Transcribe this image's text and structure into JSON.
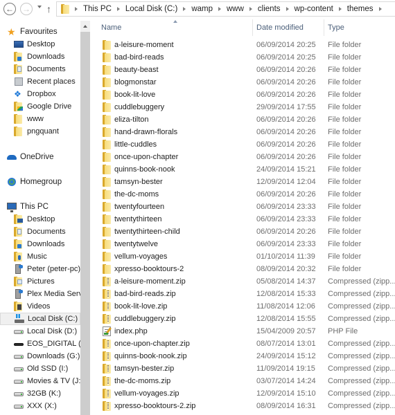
{
  "navbar": {
    "back_label": "Back",
    "forward_label": "Forward",
    "recent_label": "Recent locations",
    "up_label": "Up",
    "breadcrumbs": [
      "This PC",
      "Local Disk (C:)",
      "wamp",
      "www",
      "clients",
      "wp-content",
      "themes"
    ]
  },
  "sidebar": {
    "favourites": {
      "label": "Favourites",
      "items": [
        {
          "label": "Desktop",
          "icon": "desktop-icon"
        },
        {
          "label": "Downloads",
          "icon": "downloads-folder-icon"
        },
        {
          "label": "Documents",
          "icon": "documents-folder-icon"
        },
        {
          "label": "Recent places",
          "icon": "recent-places-icon"
        },
        {
          "label": "Dropbox",
          "icon": "dropbox-icon"
        },
        {
          "label": "Google Drive",
          "icon": "google-drive-folder-icon"
        },
        {
          "label": "www",
          "icon": "folder-icon"
        },
        {
          "label": "pngquant",
          "icon": "folder-icon"
        }
      ]
    },
    "onedrive": {
      "label": "OneDrive"
    },
    "homegroup": {
      "label": "Homegroup"
    },
    "this_pc": {
      "label": "This PC",
      "items": [
        {
          "label": "Desktop",
          "icon": "desktop-folder-icon"
        },
        {
          "label": "Documents",
          "icon": "documents-folder-icon"
        },
        {
          "label": "Downloads",
          "icon": "downloads-folder-icon"
        },
        {
          "label": "Music",
          "icon": "music-folder-icon"
        },
        {
          "label": "Peter (peter-pc)",
          "icon": "network-location-icon"
        },
        {
          "label": "Pictures",
          "icon": "pictures-folder-icon"
        },
        {
          "label": "Plex Media Serve",
          "icon": "network-location-icon"
        },
        {
          "label": "Videos",
          "icon": "videos-folder-icon"
        },
        {
          "label": "Local Disk (C:)",
          "icon": "windows-drive-icon",
          "selected": true
        },
        {
          "label": "Local Disk (D:)",
          "icon": "hard-drive-icon"
        },
        {
          "label": "EOS_DIGITAL (F:)",
          "icon": "removable-drive-icon"
        },
        {
          "label": "Downloads (G:)",
          "icon": "hard-drive-icon"
        },
        {
          "label": "Old SSD (I:)",
          "icon": "hard-drive-icon"
        },
        {
          "label": "Movies & TV (J:)",
          "icon": "hard-drive-icon"
        },
        {
          "label": "32GB (K:)",
          "icon": "hard-drive-icon"
        },
        {
          "label": "XXX (X:)",
          "icon": "hard-drive-icon"
        }
      ]
    }
  },
  "file_list": {
    "columns": {
      "name": "Name",
      "date": "Date modified",
      "type": "Type"
    },
    "sort_column": "Name",
    "sort_direction": "ascending",
    "rows": [
      {
        "name": "a-leisure-moment",
        "date": "06/09/2014 20:25",
        "type": "File folder",
        "kind": "folder"
      },
      {
        "name": "bad-bird-reads",
        "date": "06/09/2014 20:25",
        "type": "File folder",
        "kind": "folder"
      },
      {
        "name": "beauty-beast",
        "date": "06/09/2014 20:26",
        "type": "File folder",
        "kind": "folder"
      },
      {
        "name": "blogmonstar",
        "date": "06/09/2014 20:26",
        "type": "File folder",
        "kind": "folder"
      },
      {
        "name": "book-lit-love",
        "date": "06/09/2014 20:26",
        "type": "File folder",
        "kind": "folder"
      },
      {
        "name": "cuddlebuggery",
        "date": "29/09/2014 17:55",
        "type": "File folder",
        "kind": "folder"
      },
      {
        "name": "eliza-tilton",
        "date": "06/09/2014 20:26",
        "type": "File folder",
        "kind": "folder"
      },
      {
        "name": "hand-drawn-florals",
        "date": "06/09/2014 20:26",
        "type": "File folder",
        "kind": "folder"
      },
      {
        "name": "little-cuddles",
        "date": "06/09/2014 20:26",
        "type": "File folder",
        "kind": "folder"
      },
      {
        "name": "once-upon-chapter",
        "date": "06/09/2014 20:26",
        "type": "File folder",
        "kind": "folder"
      },
      {
        "name": "quinns-book-nook",
        "date": "24/09/2014 15:21",
        "type": "File folder",
        "kind": "folder"
      },
      {
        "name": "tamsyn-bester",
        "date": "12/09/2014 12:04",
        "type": "File folder",
        "kind": "folder"
      },
      {
        "name": "the-dc-moms",
        "date": "06/09/2014 20:26",
        "type": "File folder",
        "kind": "folder"
      },
      {
        "name": "twentyfourteen",
        "date": "06/09/2014 23:33",
        "type": "File folder",
        "kind": "folder"
      },
      {
        "name": "twentythirteen",
        "date": "06/09/2014 23:33",
        "type": "File folder",
        "kind": "folder"
      },
      {
        "name": "twentythirteen-child",
        "date": "06/09/2014 20:26",
        "type": "File folder",
        "kind": "folder"
      },
      {
        "name": "twentytwelve",
        "date": "06/09/2014 23:33",
        "type": "File folder",
        "kind": "folder"
      },
      {
        "name": "vellum-voyages",
        "date": "01/10/2014 11:39",
        "type": "File folder",
        "kind": "folder"
      },
      {
        "name": "xpresso-booktours-2",
        "date": "08/09/2014 20:32",
        "type": "File folder",
        "kind": "folder"
      },
      {
        "name": "a-leisure-moment.zip",
        "date": "05/08/2014 14:37",
        "type": "Compressed (zipp...",
        "kind": "zip"
      },
      {
        "name": "bad-bird-reads.zip",
        "date": "12/08/2014 15:33",
        "type": "Compressed (zipp...",
        "kind": "zip"
      },
      {
        "name": "book-lit-love.zip",
        "date": "11/08/2014 12:06",
        "type": "Compressed (zipp...",
        "kind": "zip"
      },
      {
        "name": "cuddlebuggery.zip",
        "date": "12/08/2014 15:55",
        "type": "Compressed (zipp...",
        "kind": "zip"
      },
      {
        "name": "index.php",
        "date": "15/04/2009 20:57",
        "type": "PHP File",
        "kind": "php"
      },
      {
        "name": "once-upon-chapter.zip",
        "date": "08/07/2014 13:01",
        "type": "Compressed (zipp...",
        "kind": "zip"
      },
      {
        "name": "quinns-book-nook.zip",
        "date": "24/09/2014 15:12",
        "type": "Compressed (zipp...",
        "kind": "zip"
      },
      {
        "name": "tamsyn-bester.zip",
        "date": "11/09/2014 19:15",
        "type": "Compressed (zipp...",
        "kind": "zip"
      },
      {
        "name": "the-dc-moms.zip",
        "date": "03/07/2014 14:24",
        "type": "Compressed (zipp...",
        "kind": "zip"
      },
      {
        "name": "vellum-voyages.zip",
        "date": "12/09/2014 15:10",
        "type": "Compressed (zipp...",
        "kind": "zip"
      },
      {
        "name": "xpresso-booktours-2.zip",
        "date": "08/09/2014 16:31",
        "type": "Compressed (zipp...",
        "kind": "zip"
      }
    ]
  }
}
